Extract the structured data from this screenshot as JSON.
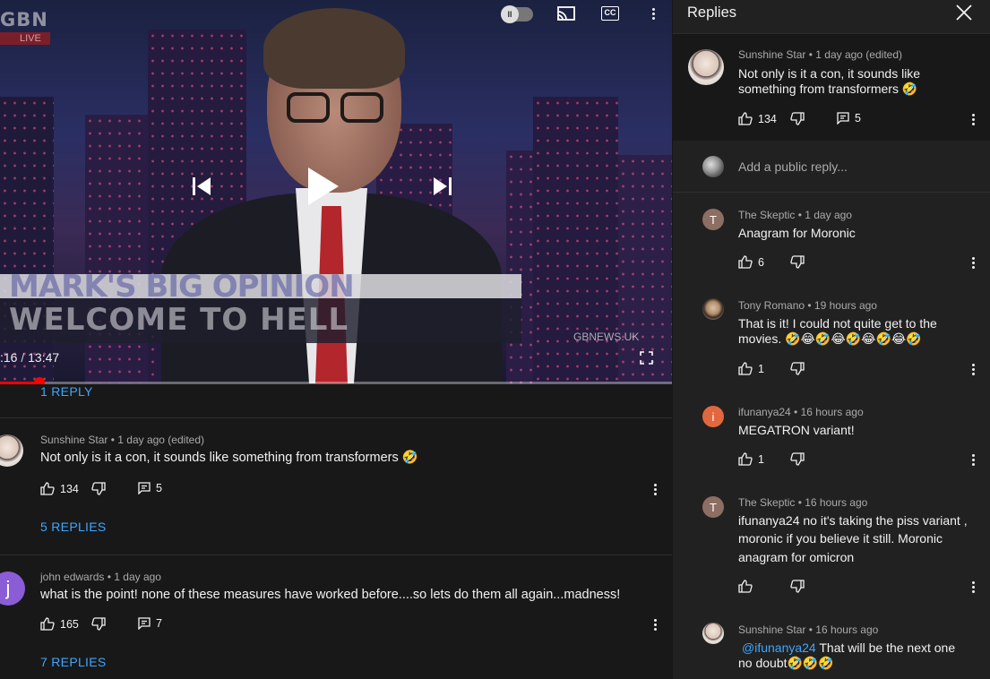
{
  "player": {
    "channel_logo": "GBN",
    "live_label": "LIVE",
    "banner_line1": "MARK'S BIG OPINION",
    "banner_line2": "WELCOME TO HELL",
    "watermark": "GBNEWS.UK",
    "current_time": ":16",
    "time_separator": "/",
    "duration": "13:47",
    "progress_fraction": 0.058,
    "icons": [
      "autoplay-toggle",
      "cast-icon",
      "captions-icon",
      "more-vert-icon",
      "previous-icon",
      "play-icon",
      "next-icon",
      "fullscreen-icon"
    ],
    "captions_label": "CC",
    "autoplay_label": "II"
  },
  "comments": {
    "top_reply_link": "1 REPLY",
    "items": [
      {
        "author": "Sunshine Star",
        "time": "1 day ago (edited)",
        "text": "Not only is it a con, it sounds like something from transformers 🤣",
        "likes": "134",
        "reply_count": "5",
        "replies_link": "5 REPLIES"
      },
      {
        "author": "john edwards",
        "time": "1 day ago",
        "avatar_letter": "j",
        "avatar_color": "#8a5cd6",
        "text": "what is the point! none of these measures have worked before....so lets do them all again...madness!",
        "likes": "165",
        "reply_count": "7",
        "replies_link": "7 REPLIES"
      }
    ]
  },
  "replies_panel": {
    "title": "Replies",
    "reply_placeholder": "Add a public reply...",
    "parent": {
      "author": "Sunshine Star",
      "time": "1 day ago (edited)",
      "text_line1": "Not only is it a con, it sounds like",
      "text_line2": "something from transformers 🤣",
      "likes": "134",
      "reply_count": "5"
    },
    "replies": [
      {
        "author": "The Skeptic",
        "time": "1 day ago",
        "avatar_letter": "T",
        "avatar_color": "#8d6e63",
        "lines": [
          "Anagram for Moronic"
        ],
        "likes": "6"
      },
      {
        "author": "Tony Romano",
        "time": "19 hours ago",
        "lines": [
          "That is it! I could not quite get to the",
          "movies. 🤣😂🤣😂🤣😂🤣😂🤣"
        ],
        "likes": "1"
      },
      {
        "author": "ifunanya24",
        "time": "16 hours ago",
        "avatar_letter": "i",
        "avatar_color": "#e2673e",
        "lines": [
          "MEGATRON variant!"
        ],
        "likes": "1"
      },
      {
        "author": "The Skeptic",
        "time": "16 hours ago",
        "avatar_letter": "T",
        "avatar_color": "#8d6e63",
        "lines": [
          "ifunanya24 no it's taking the piss variant ,",
          "moronic if you believe it still. Moronic",
          "anagram for omicron"
        ],
        "likes": ""
      },
      {
        "author": "Sunshine Star",
        "time": "16 hours ago",
        "mention": "@ifunanya24",
        "line1_rest": " That will be the next one",
        "line2": "no doubt🤣🤣🤣"
      }
    ]
  }
}
